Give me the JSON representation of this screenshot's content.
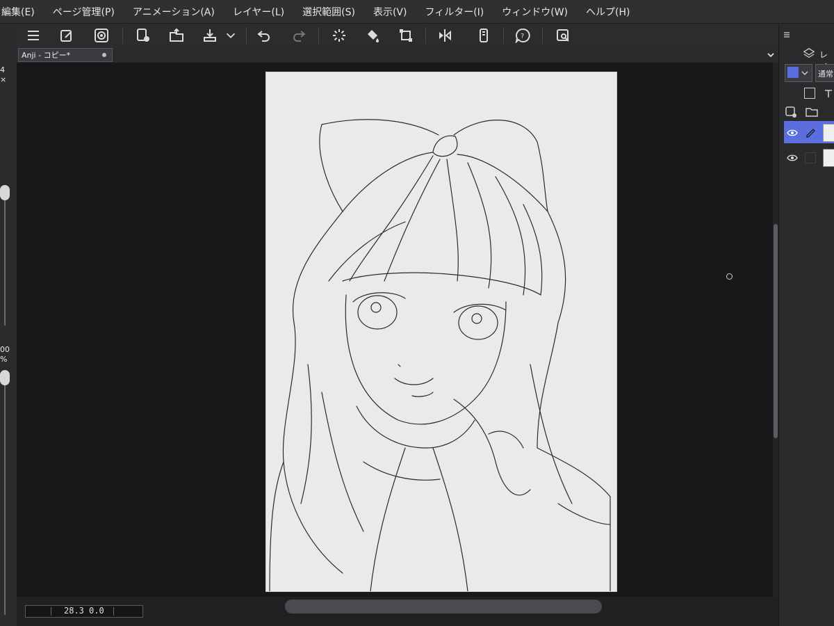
{
  "menubar": {
    "items": [
      "編集(E)",
      "ページ管理(P)",
      "アニメーション(A)",
      "レイヤー(L)",
      "選択範囲(S)",
      "表示(V)",
      "フィルター(I)",
      "ウィンドウ(W)",
      "ヘルプ(H)"
    ]
  },
  "tab": {
    "title": "Anji - コピー*"
  },
  "statusbar": {
    "zoom": "28.3",
    "rotation": "0.0"
  },
  "left_strip": {
    "brush_size_digit": "4",
    "opacity_value": "00",
    "opacity_unit": "%"
  },
  "right_panel": {
    "blend_mode": "通常",
    "panel_tab_label": "レイ"
  },
  "colors": {
    "accent": "#5b6ee0",
    "panel_bg": "#2a2b2d",
    "canvas_bg": "#171819",
    "paper": "#e9eaea"
  },
  "icons": [
    "menu-icon",
    "new-file-icon",
    "gallery-icon",
    "new-page-icon",
    "open-folder-icon",
    "export-icon",
    "dropdown-chevron-icon",
    "undo-icon",
    "redo-icon",
    "loading-icon",
    "fill-icon",
    "transform-icon",
    "flip-icon",
    "smartphone-icon",
    "help-icon",
    "search-canvas-icon"
  ]
}
